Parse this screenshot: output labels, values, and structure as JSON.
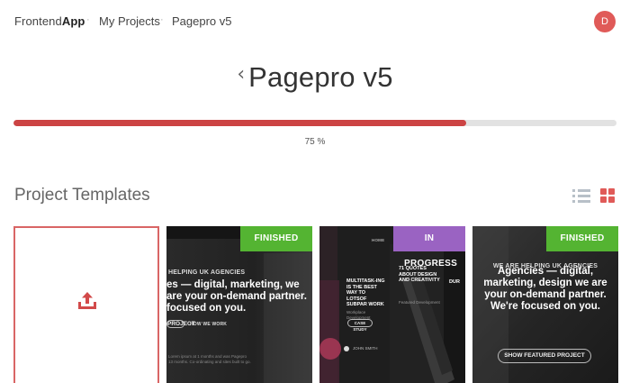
{
  "header": {
    "brand_light": "Frontend",
    "brand_bold": "App",
    "breadcrumb": [
      "My Projects",
      "Pagepro v5"
    ],
    "separator": "·",
    "avatar_initial": "D"
  },
  "page": {
    "back_glyph": "‹",
    "title": "Pagepro v5"
  },
  "progress": {
    "value": 0.75,
    "label": "75 %"
  },
  "templates": {
    "section_title": "Project Templates",
    "view_modes": [
      "list-icon",
      "grid-icon"
    ],
    "active_view": "grid",
    "cards": [
      {
        "type": "upload",
        "icon": "upload-icon"
      },
      {
        "status": "FINISHED",
        "kicker": "HELPING UK AGENCIES",
        "headline": "es — digital, marketing, we are your on-demand partner. focused on you.",
        "buttons": [
          "PROJECT",
          "HOW WE WORK"
        ],
        "footnote": "Lorem ipsum at 1 months and was Pagepro 13 months. Co-ordinating and sites built to go."
      },
      {
        "status": "IN PROGRESS",
        "kicker": "HOME",
        "headline_left": "MULTITASK-ING IS THE BEST WAY TO LOTSOF SUBPAR WORK",
        "headline_mid": "71 QUOTES ABOUT DESIGN AND CREATIVITY",
        "headline_right": "DUR",
        "caption": "Workplace Development",
        "caption_mid": "Featured Development",
        "button": "CASE STUDY",
        "author": "JOHN SMITH"
      },
      {
        "status": "FINISHED",
        "kicker": "WE ARE HELPING UK AGENCIES",
        "headline": "Agencies — digital, marketing, design we are your on-demand partner. We're focused on you.",
        "button": "SHOW FEATURED PROJECT"
      }
    ]
  },
  "colors": {
    "accent": "#cc4444",
    "finished": "#54b432",
    "in_progress": "#9a63c2",
    "avatar": "#e05a58"
  }
}
